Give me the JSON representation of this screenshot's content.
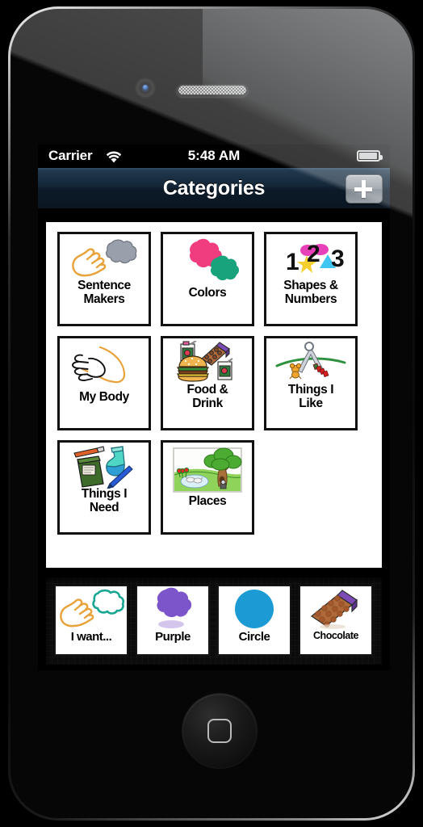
{
  "device": {
    "name": "smartphone-mockup",
    "camera_icon": "camera-icon",
    "speaker_icon": "earpiece-speaker-icon",
    "home_button_icon": "home-button-icon"
  },
  "status_bar": {
    "carrier": "Carrier",
    "wifi_icon": "wifi-icon",
    "time": "5:48 AM",
    "battery_icon": "battery-icon",
    "battery_level_percent": 88
  },
  "nav_bar": {
    "title": "Categories",
    "add_button_label": "+",
    "add_button_icon": "plus-icon"
  },
  "grid": {
    "items": [
      {
        "label": "Sentence Makers",
        "line1": "Sentence",
        "line2": "Makers",
        "icon": "hand-speech-icon"
      },
      {
        "label": "Colors",
        "line1": "Colors",
        "line2": "",
        "icon": "paint-blobs-icon"
      },
      {
        "label": "Shapes & Numbers",
        "line1": "Shapes &",
        "line2": "Numbers",
        "icon": "shapes-numbers-icon"
      },
      {
        "label": "My Body",
        "line1": "My Body",
        "line2": "",
        "icon": "hand-foot-icon"
      },
      {
        "label": "Food & Drink",
        "line1": "Food &",
        "line2": "Drink",
        "icon": "burger-drink-icon"
      },
      {
        "label": "Things I Like",
        "line1": "Things I",
        "line2": "Like",
        "icon": "toys-icon"
      },
      {
        "label": "Things I Need",
        "line1": "Things I",
        "line2": "Need",
        "icon": "book-sock-icon"
      },
      {
        "label": "Places",
        "line1": "Places",
        "line2": "",
        "icon": "park-scene-icon"
      }
    ]
  },
  "tray": {
    "items": [
      {
        "label": "I want...",
        "icon": "hand-speech-teal-icon",
        "small": false
      },
      {
        "label": "Purple",
        "icon": "purple-blob-icon",
        "small": false
      },
      {
        "label": "Circle",
        "icon": "blue-circle-icon",
        "small": false
      },
      {
        "label": "Chocolate",
        "icon": "chocolate-bar-icon",
        "small": true
      }
    ]
  },
  "colors": {
    "navbar_top": "#32506b",
    "navbar_bottom": "#0a1622",
    "pink": "#ef3d7f",
    "teal": "#18a37d",
    "purple": "#7b55c9",
    "blue": "#1b9ad4",
    "yellow": "#f5cf2e",
    "cyan": "#3ec6f0",
    "magenta": "#e840b8"
  }
}
